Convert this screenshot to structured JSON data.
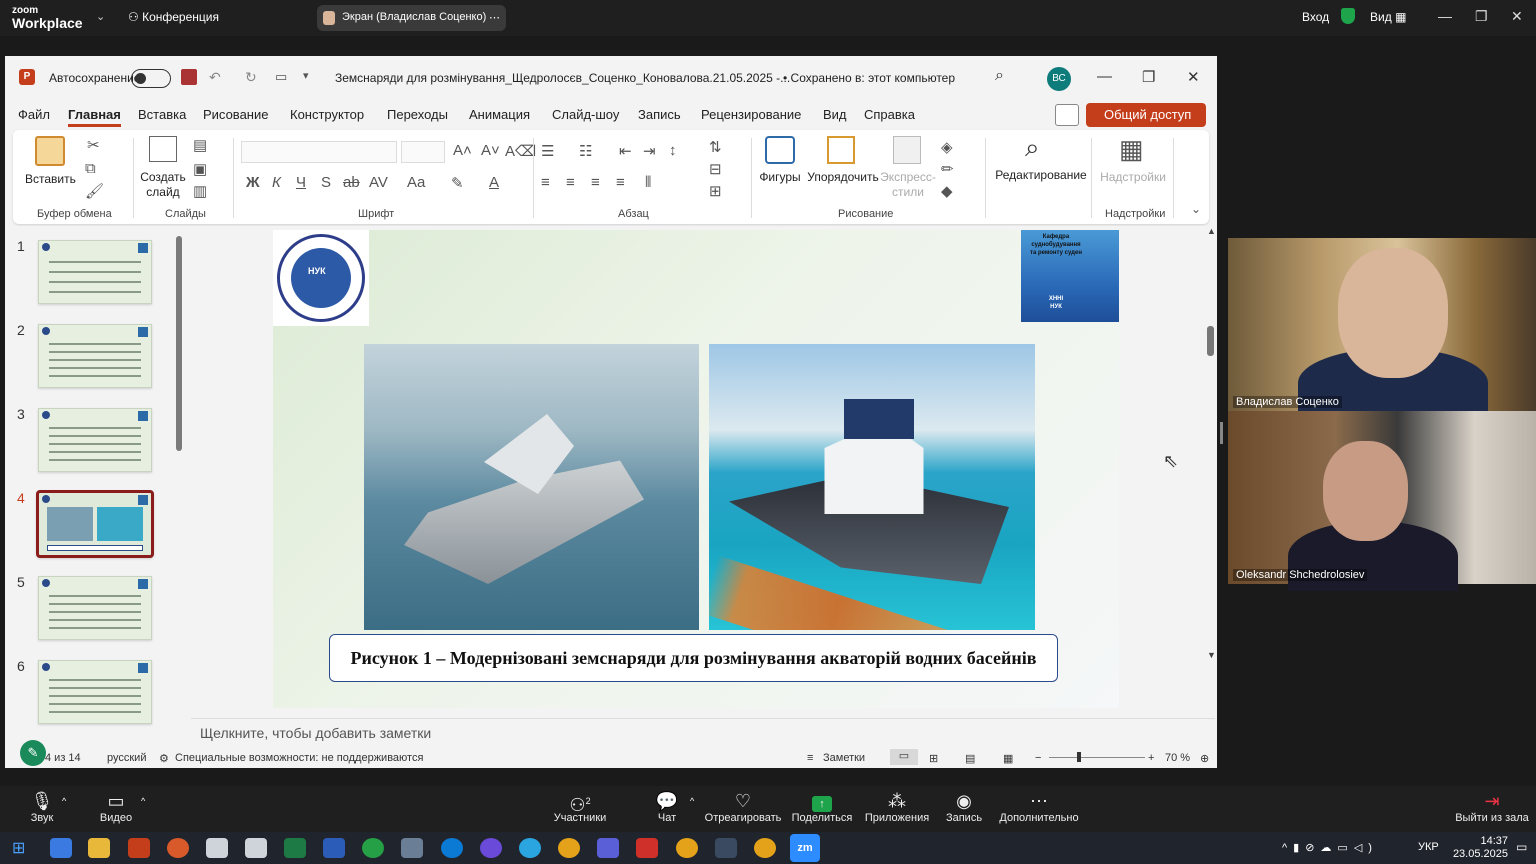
{
  "zoom_top": {
    "logo_top": "zoom",
    "logo_bottom": "Workplace",
    "conference_label": "Конференция",
    "share_label": "Экран (Владислав Соценко)",
    "login_label": "Вход",
    "view_label": "Вид"
  },
  "ppt": {
    "autosave_label": "Автосохранение",
    "doc_title": "Земснаряди для розмінування_Щедролосєв_Соценко_Коновалова.21.05.2025  -...",
    "saved_label": "• Сохранено в: этот компьютер",
    "avatar": "ВС",
    "menu": [
      "Файл",
      "Главная",
      "Вставка",
      "Рисование",
      "Конструктор",
      "Переходы",
      "Анимация",
      "Слайд-шоу",
      "Запись",
      "Рецензирование",
      "Вид",
      "Справка"
    ],
    "share_button": "Общий доступ",
    "ribbon": {
      "paste": "Вставить",
      "new_slide_1": "Создать",
      "new_slide_2": "слайд",
      "shapes": "Фигуры",
      "arrange": "Упорядочить",
      "express_1": "Экспресс-",
      "express_2": "стили",
      "editing": "Редактирование",
      "settings": "Надстройки",
      "groups": [
        "Буфер обмена",
        "Слайды",
        "Шрифт",
        "Абзац",
        "Рисование",
        "Надстройки"
      ]
    },
    "thumbnail_numbers": [
      "1",
      "2",
      "3",
      "4",
      "5",
      "6"
    ],
    "slide": {
      "seal_text": "НУК",
      "dept_lines": [
        "Кафедра",
        "суднобудування",
        "та ремонту суден",
        "ХННІ",
        "НУК"
      ],
      "caption": "Рисунок 1 – Модернізовані земснаряди для розмінування акваторій водних басейнів"
    },
    "notes_placeholder": "Щелкните, чтобы добавить заметки",
    "status": {
      "slide_of": "4 из 14",
      "language": "русский",
      "accessibility": "Специальные возможности: не поддерживаются",
      "notes": "Заметки",
      "zoom": "70 %"
    }
  },
  "participants": [
    {
      "name": "Владислав Соценко"
    },
    {
      "name": "Oleksandr Shchedrolosiev"
    }
  ],
  "zoom_controls": {
    "audio": "Звук",
    "video": "Видео",
    "participants": "Участники",
    "participants_count": "2",
    "chat": "Чат",
    "react": "Отреагировать",
    "share": "Поделиться",
    "apps": "Приложения",
    "record": "Запись",
    "more": "Дополнительно",
    "leave": "Выйти из зала"
  },
  "taskbar": {
    "lang": "УКР",
    "time": "14:37",
    "date": "23.05.2025"
  },
  "colors": {
    "ppt_accent": "#c43e1c",
    "zoom_share_green": "#1ea54c"
  }
}
